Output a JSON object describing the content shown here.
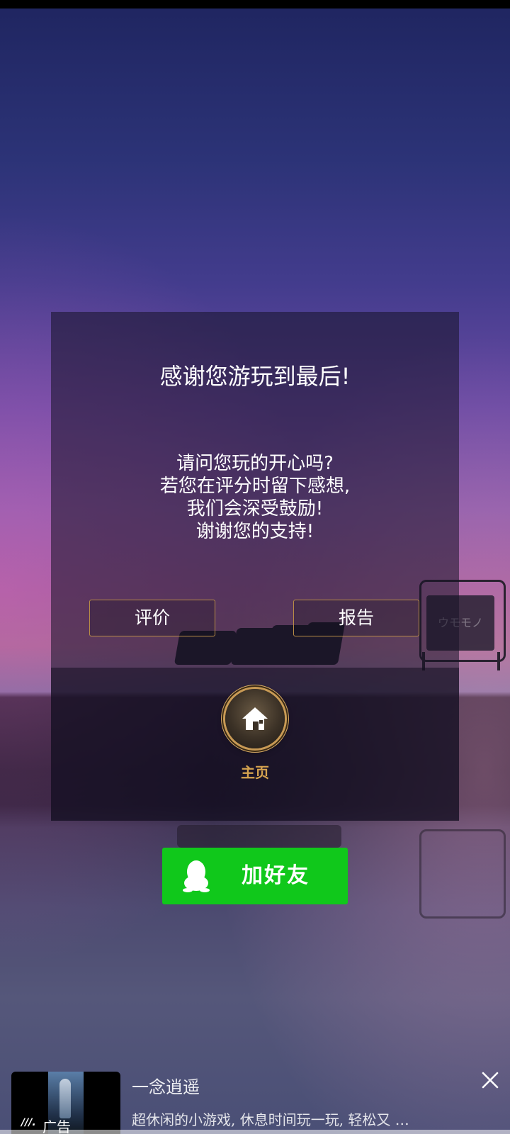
{
  "dialog": {
    "title": "感谢您游玩到最后!",
    "message_lines": [
      "请问您玩的开心吗?",
      "若您在评分时留下感想,",
      "我们会深受鼓励!",
      "谢谢您的支持!"
    ],
    "rate_button": "评价",
    "report_button": "报告",
    "home_label": "主页"
  },
  "background": {
    "sign_text": "ウモモノ"
  },
  "add_friend": {
    "label": "加好友",
    "color": "#10c81b"
  },
  "ad": {
    "badge": "广告",
    "title": "一念逍遥",
    "description": "超休闲的小游戏, 休息时间玩一玩, 轻松又 …"
  },
  "colors": {
    "button_border": "#b98d45",
    "home_label": "#d5a34f"
  }
}
